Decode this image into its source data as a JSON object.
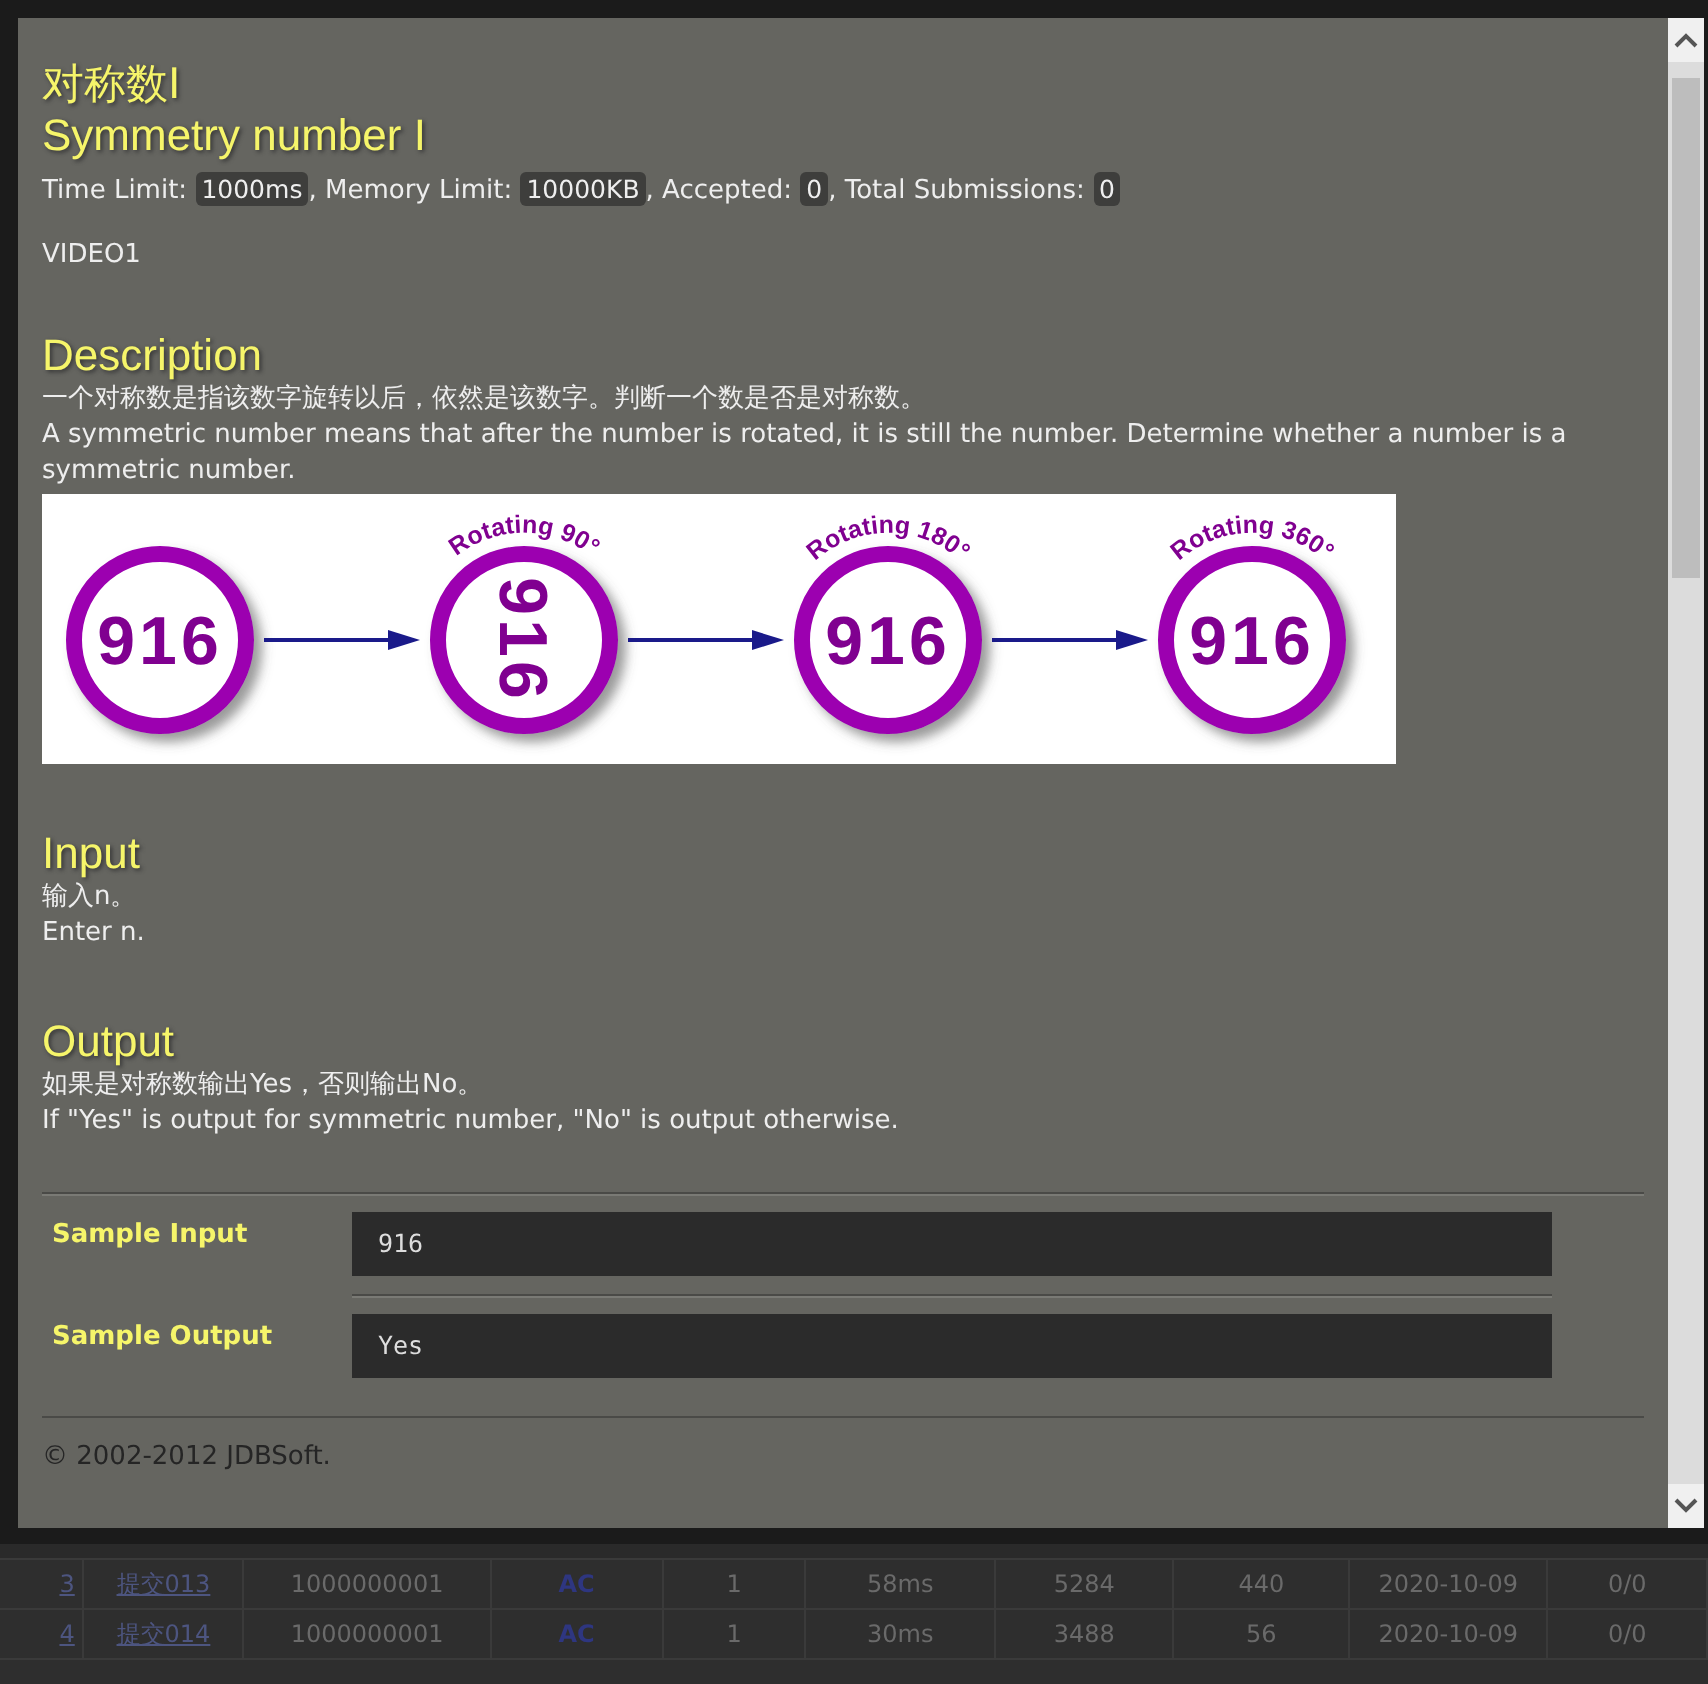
{
  "problem": {
    "title_zh": "对称数I",
    "title_en": "Symmetry number I",
    "limits": [
      {
        "label": "Time Limit:",
        "value": "1000ms"
      },
      {
        "label": ", Memory Limit:",
        "value": "10000KB"
      },
      {
        "label": ", Accepted:",
        "value": "0"
      },
      {
        "label": ", Total Submissions:",
        "value": "0"
      }
    ],
    "source": "VIDEO1",
    "sections": [
      {
        "heading": "Description",
        "lines": [
          "一个对称数是指该数字旋转以后，依然是该数字。判断一个数是否是对称数。",
          "A symmetric number means that after the number is rotated, it is still the number. Determine whether a number is a symmetric number."
        ],
        "diagram": {
          "steps": [
            {
              "number": "916",
              "kind": "upright"
            },
            {
              "caption": "Rotating 90°",
              "number": "916",
              "kind": "turned"
            },
            {
              "caption": "Rotating 180°",
              "number": "916",
              "kind": "upright"
            },
            {
              "caption": "Rotating 360°",
              "number": "916",
              "kind": "upright"
            }
          ]
        }
      },
      {
        "heading": "Input",
        "lines": [
          "输入n。",
          "Enter n."
        ]
      },
      {
        "heading": "Output",
        "lines": [
          "如果是对称数输出Yes，否则输出No。",
          "If \"Yes\" is output for symmetric number, \"No\" is output otherwise."
        ]
      }
    ],
    "samples": [
      {
        "label": "Sample Input",
        "value": "916"
      },
      {
        "label": "Sample Output",
        "value": "Yes"
      }
    ],
    "footer": "© 2002-2012  JDBSoft."
  },
  "background_table": {
    "rows": [
      {
        "cells": [
          "3",
          "提交013",
          "1000000001",
          "AC",
          "1",
          "58ms",
          "5284",
          "440",
          "2020-10-09",
          "0/0"
        ]
      },
      {
        "cells": [
          "4",
          "提交014",
          "1000000001",
          "AC",
          "1",
          "30ms",
          "3488",
          "56",
          "2020-10-09",
          "0/0"
        ]
      }
    ]
  }
}
